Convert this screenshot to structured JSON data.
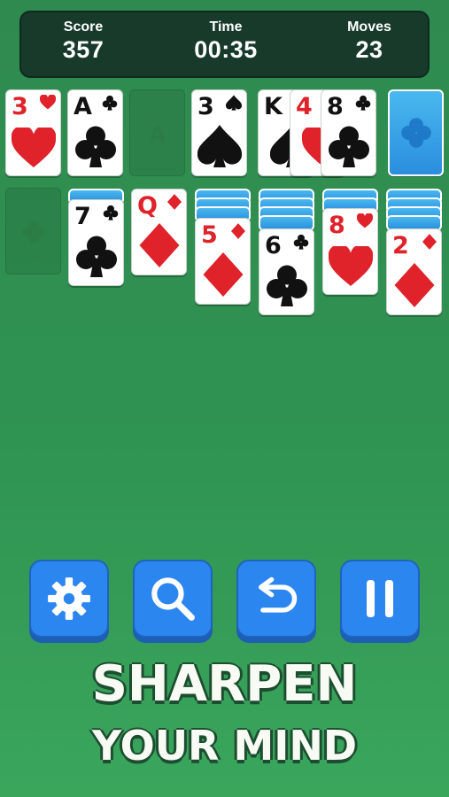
{
  "hud": {
    "score": {
      "label": "Score",
      "value": "357"
    },
    "time": {
      "label": "Time",
      "value": "00:35"
    },
    "moves": {
      "label": "Moves",
      "value": "23"
    }
  },
  "foundations": [
    {
      "rank": "3",
      "suit": "hearts",
      "color": "red"
    },
    {
      "rank": "A",
      "suit": "clubs",
      "color": "black"
    },
    {
      "rank": "",
      "empty_label": "A"
    }
  ],
  "waste": [
    {
      "rank": "3",
      "suit": "spades",
      "color": "black"
    },
    {
      "rank": "K",
      "suit": "spades",
      "color": "black"
    },
    {
      "rank": "4",
      "suit": "hearts",
      "color": "red"
    },
    {
      "rank": "8",
      "suit": "clubs",
      "color": "black"
    }
  ],
  "stock": {
    "icon": "clover-icon"
  },
  "tableau": [
    {
      "hidden": 0,
      "top": null,
      "empty_icon": "clover-icon"
    },
    {
      "hidden": 1,
      "top": {
        "rank": "7",
        "suit": "clubs",
        "color": "black"
      }
    },
    {
      "hidden": 0,
      "top": {
        "rank": "Q",
        "suit": "diamonds",
        "color": "red"
      }
    },
    {
      "hidden": 3,
      "top": {
        "rank": "5",
        "suit": "diamonds",
        "color": "red"
      }
    },
    {
      "hidden": 4,
      "top": {
        "rank": "6",
        "suit": "clubs",
        "color": "black"
      }
    },
    {
      "hidden": 2,
      "top": {
        "rank": "8",
        "suit": "hearts",
        "color": "red"
      }
    },
    {
      "hidden": 4,
      "top": {
        "rank": "2",
        "suit": "diamonds",
        "color": "red"
      }
    }
  ],
  "controls": [
    "settings",
    "hint",
    "undo",
    "pause"
  ],
  "slogan": {
    "line1": "SHARPEN",
    "line2": "YOUR MIND"
  },
  "colors": {
    "felt": "#2f9352",
    "hud": "#173a2a",
    "button": "#2c86f0",
    "red_suit": "#e0222b"
  }
}
